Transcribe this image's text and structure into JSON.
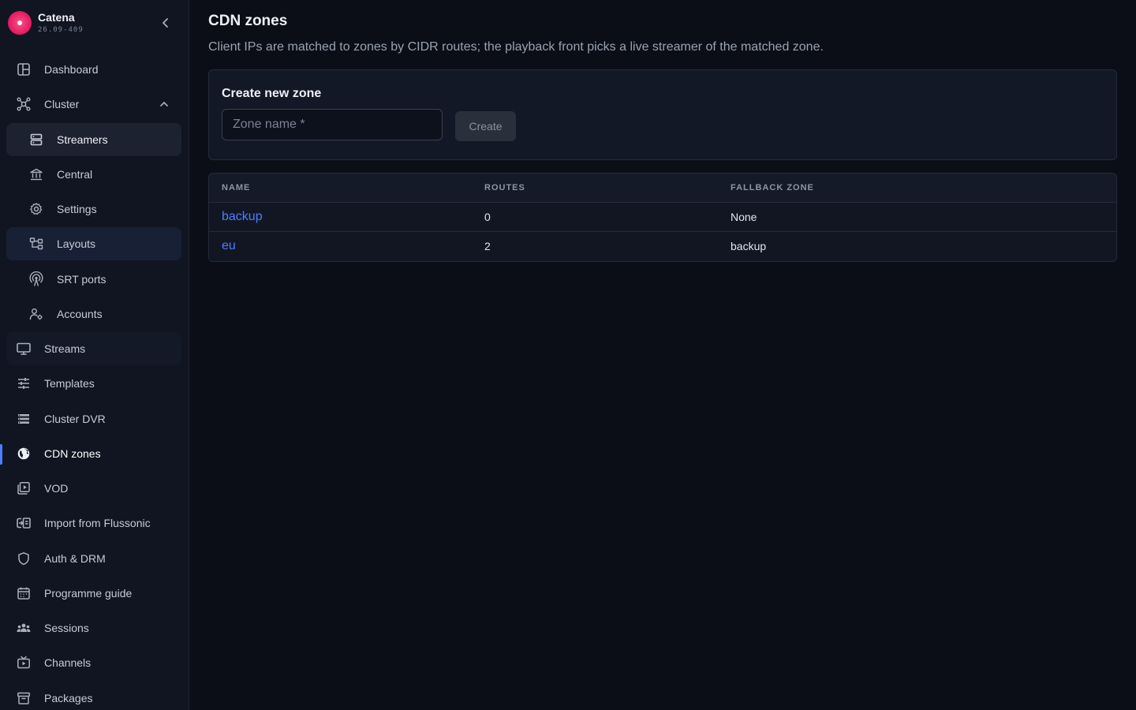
{
  "brand": {
    "name": "Catena",
    "version": "26.09-409"
  },
  "sidebar": {
    "items": [
      {
        "label": "Dashboard",
        "icon": "dashboard-icon"
      },
      {
        "label": "Cluster",
        "icon": "cluster-icon",
        "expanded": true
      },
      {
        "label": "Streamers",
        "icon": "streamers-icon"
      },
      {
        "label": "Central",
        "icon": "central-icon"
      },
      {
        "label": "Settings",
        "icon": "gear-icon"
      },
      {
        "label": "Layouts",
        "icon": "layouts-icon"
      },
      {
        "label": "SRT ports",
        "icon": "antenna-icon"
      },
      {
        "label": "Accounts",
        "icon": "accounts-icon"
      },
      {
        "label": "Streams",
        "icon": "monitor-icon"
      },
      {
        "label": "Templates",
        "icon": "sliders-icon"
      },
      {
        "label": "Cluster DVR",
        "icon": "dvr-icon"
      },
      {
        "label": "CDN zones",
        "icon": "globe-icon",
        "active": true
      },
      {
        "label": "VOD",
        "icon": "vod-icon"
      },
      {
        "label": "Import from Flussonic",
        "icon": "import-icon"
      },
      {
        "label": "Auth & DRM",
        "icon": "shield-icon"
      },
      {
        "label": "Programme guide",
        "icon": "calendar-icon"
      },
      {
        "label": "Sessions",
        "icon": "users-icon"
      },
      {
        "label": "Channels",
        "icon": "tv-icon"
      },
      {
        "label": "Packages",
        "icon": "archive-icon"
      }
    ]
  },
  "page": {
    "title": "CDN zones",
    "description": "Client IPs are matched to zones by CIDR routes; the playback front picks a live streamer of the matched zone."
  },
  "create_card": {
    "title": "Create new zone",
    "input_placeholder": "Zone name *",
    "input_value": "",
    "create_label": "Create"
  },
  "table": {
    "headers": [
      "NAME",
      "ROUTES",
      "FALLBACK ZONE"
    ],
    "rows": [
      {
        "name": "backup",
        "routes": "0",
        "fallback": "None"
      },
      {
        "name": "eu",
        "routes": "2",
        "fallback": "backup"
      }
    ]
  },
  "colors": {
    "accent": "#4f7dff",
    "brand": "#e01a5f",
    "background": "#0b0e17",
    "sidebar": "#111522"
  }
}
